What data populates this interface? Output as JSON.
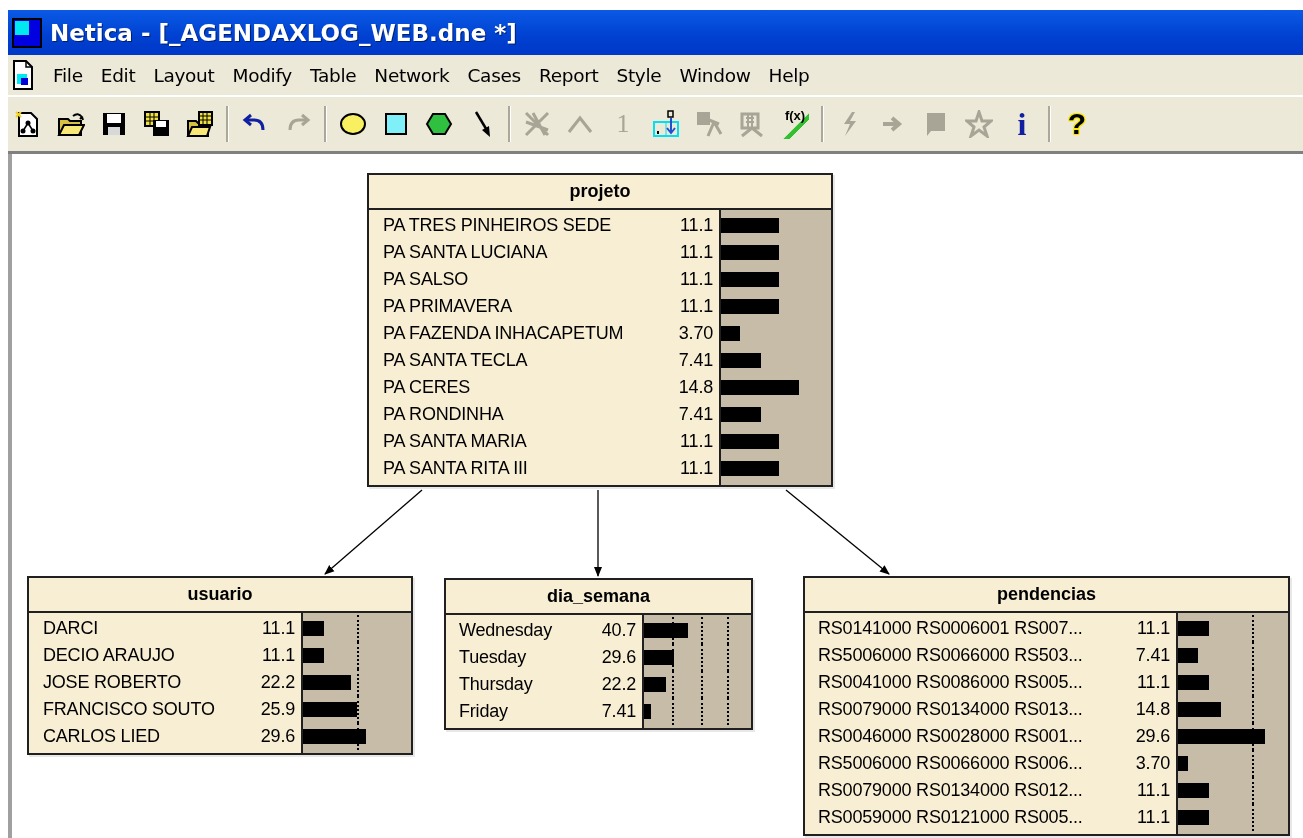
{
  "window": {
    "title": "Netica - [_AGENDAXLOG_WEB.dne *]"
  },
  "menu": [
    "File",
    "Edit",
    "Layout",
    "Modify",
    "Table",
    "Network",
    "Cases",
    "Report",
    "Style",
    "Window",
    "Help"
  ],
  "toolbar": [
    [
      {
        "disabled": false
      },
      {
        "disabled": false
      },
      {
        "disabled": false
      },
      {
        "disabled": false
      },
      {
        "disabled": false
      }
    ],
    [
      {
        "disabled": false
      },
      {
        "disabled": true
      }
    ],
    [
      {
        "disabled": false
      },
      {
        "disabled": false
      },
      {
        "disabled": false
      },
      {
        "disabled": false
      }
    ],
    [
      {
        "disabled": true
      },
      {
        "disabled": true
      },
      {
        "disabled": true,
        "glyph": "1"
      },
      {
        "disabled": false
      },
      {
        "disabled": true
      },
      {
        "disabled": true
      },
      {
        "disabled": false,
        "glyph": "f(x)"
      }
    ],
    [
      {
        "disabled": true
      },
      {
        "disabled": true
      },
      {
        "disabled": true
      },
      {
        "disabled": true
      },
      {
        "disabled": false,
        "glyph": "i"
      }
    ],
    [
      {
        "disabled": false,
        "glyph": "?"
      }
    ]
  ],
  "nodes": [
    {
      "name": "projeto",
      "states": [
        {
          "label": "PA TRES PINHEIROS SEDE",
          "value": "11.1",
          "level": 0.53
        },
        {
          "label": "PA SANTA LUCIANA",
          "value": "11.1",
          "level": 0.53
        },
        {
          "label": "PA SALSO",
          "value": "11.1",
          "level": 0.53
        },
        {
          "label": "PA PRIMAVERA",
          "value": "11.1",
          "level": 0.53
        },
        {
          "label": "PA FAZENDA INHACAPETUM",
          "value": "3.70",
          "level": 0.17
        },
        {
          "label": "PA SANTA TECLA",
          "value": "7.41",
          "level": 0.36
        },
        {
          "label": "PA CERES",
          "value": "14.8",
          "level": 0.71
        },
        {
          "label": "PA RONDINHA",
          "value": "7.41",
          "level": 0.36
        },
        {
          "label": "PA SANTA MARIA",
          "value": "11.1",
          "level": 0.53
        },
        {
          "label": "PA SANTA RITA III",
          "value": "11.1",
          "level": 0.53
        }
      ]
    },
    {
      "name": "usuario",
      "states": [
        {
          "label": "DARCI",
          "value": "11.1",
          "level": 0.19
        },
        {
          "label": "DECIO ARAUJO",
          "value": "11.1",
          "level": 0.19
        },
        {
          "label": "JOSE ROBERTO",
          "value": "22.2",
          "level": 0.44
        },
        {
          "label": "FRANCISCO SOUTO",
          "value": "25.9",
          "level": 0.5
        },
        {
          "label": "CARLOS LIED",
          "value": "29.6",
          "level": 0.58
        }
      ]
    },
    {
      "name": "dia_semana",
      "states": [
        {
          "label": "Wednesday",
          "value": "40.7",
          "level": 0.41
        },
        {
          "label": "Tuesday",
          "value": "29.6",
          "level": 0.28
        },
        {
          "label": "Thursday",
          "value": "22.2",
          "level": 0.21
        },
        {
          "label": "Friday",
          "value": "7.41",
          "level": 0.07
        }
      ]
    },
    {
      "name": "pendencias",
      "states": [
        {
          "label": "RS0141000 RS0006001 RS007...",
          "value": "11.1",
          "level": 0.28
        },
        {
          "label": "RS5006000 RS0066000 RS503...",
          "value": "7.41",
          "level": 0.18
        },
        {
          "label": "RS0041000 RS0086000 RS005...",
          "value": "11.1",
          "level": 0.28
        },
        {
          "label": "RS0079000 RS0134000 RS013...",
          "value": "14.8",
          "level": 0.39
        },
        {
          "label": "RS0046000 RS0028000 RS001...",
          "value": "29.6",
          "level": 0.79
        },
        {
          "label": "RS5006000 RS0066000 RS006...",
          "value": "3.70",
          "level": 0.09
        },
        {
          "label": "RS0079000 RS0134000 RS012...",
          "value": "11.1",
          "level": 0.28
        },
        {
          "label": "RS0059000 RS0121000 RS005...",
          "value": "11.1",
          "level": 0.28
        }
      ]
    }
  ]
}
